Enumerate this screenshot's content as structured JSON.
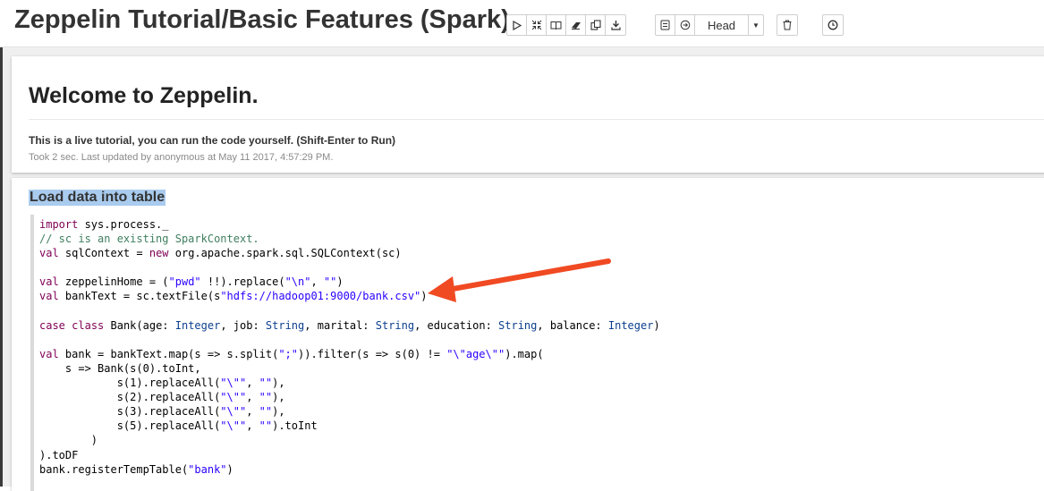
{
  "notebook": {
    "title": "Zeppelin Tutorial/Basic Features (Spark)",
    "toolbar": {
      "run_all_icon": "play-icon",
      "show_hide_code_icon": "collapse-arrows-icon",
      "show_hide_output_icon": "book-icon",
      "clear_output_icon": "eraser-icon",
      "clone_icon": "copy-icon",
      "export_icon": "download-icon",
      "version_control_icon": "commit-icon",
      "revision_icon": "arrow-circle-icon",
      "revision_label": "Head",
      "delete_icon": "trash-icon",
      "scheduler_icon": "clock-icon"
    }
  },
  "paragraphs": [
    {
      "title": "Welcome to Zeppelin.",
      "text": "This is a live tutorial, you can run the code yourself. (Shift-Enter to Run)",
      "status": "Took 2 sec. Last updated by anonymous at May 11 2017, 4:57:29 PM."
    },
    {
      "title": "Load data into table",
      "code": [
        "import sys.process._",
        "// sc is an existing SparkContext.",
        "val sqlContext = new org.apache.spark.sql.SQLContext(sc)",
        "",
        "val zeppelinHome = (\"pwd\" !!).replace(\"\\n\", \"\")",
        "val bankText = sc.textFile(s\"hdfs://hadoop01:9000/bank.csv\")",
        "",
        "case class Bank(age: Integer, job: String, marital: String, education: String, balance: Integer)",
        "",
        "val bank = bankText.map(s => s.split(\";\")).filter(s => s(0) != \"\\\"age\\\"\").map(",
        "    s => Bank(s(0).toInt,",
        "            s(1).replaceAll(\"\\\"\", \"\"),",
        "            s(2).replaceAll(\"\\\"\", \"\"),",
        "            s(3).replaceAll(\"\\\"\", \"\"),",
        "            s(5).replaceAll(\"\\\"\", \"\").toInt",
        "        )",
        ").toDF",
        "bank.registerTempTable(\"bank\")"
      ]
    }
  ],
  "colors": {
    "keyword": "#7f0055",
    "comment": "#3f7f5f",
    "string": "#2a00ff",
    "title_highlight": "#a9cbee",
    "annotation_arrow": "#f04a23"
  }
}
